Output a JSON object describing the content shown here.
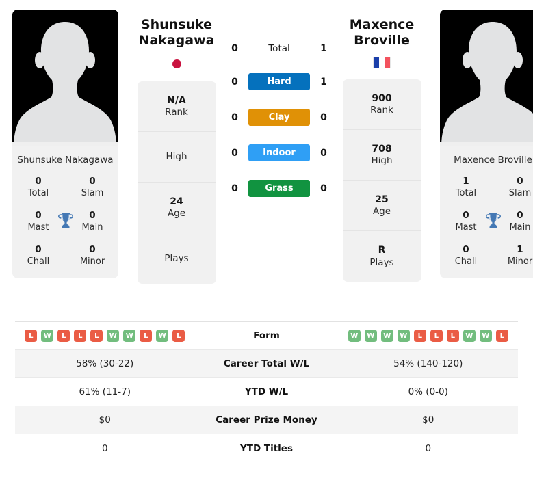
{
  "players": {
    "left": {
      "name": "Shunsuke Nakagawa",
      "name_line1": "Shunsuke",
      "name_line2": "Nakagawa",
      "country_flag": "jp-flag-icon",
      "rank": "N/A",
      "rank_label": "Rank",
      "high": "",
      "high_label": "High",
      "age": "24",
      "age_label": "Age",
      "plays": "",
      "plays_label": "Plays",
      "titles": {
        "total": "0",
        "total_label": "Total",
        "slam": "0",
        "slam_label": "Slam",
        "mast": "0",
        "mast_label": "Mast",
        "main": "0",
        "main_label": "Main",
        "chall": "0",
        "chall_label": "Chall",
        "minor": "0",
        "minor_label": "Minor"
      },
      "form": [
        "L",
        "W",
        "L",
        "L",
        "L",
        "W",
        "W",
        "L",
        "W",
        "L"
      ],
      "career_total_wl": "58% (30-22)",
      "ytd_wl": "61% (11-7)",
      "career_prize_money": "$0",
      "ytd_titles": "0"
    },
    "right": {
      "name": "Maxence Broville",
      "name_line1": "Maxence",
      "name_line2": "Broville",
      "country_flag": "fr-flag-icon",
      "rank": "900",
      "rank_label": "Rank",
      "high": "708",
      "high_label": "High",
      "age": "25",
      "age_label": "Age",
      "plays": "R",
      "plays_label": "Plays",
      "titles": {
        "total": "1",
        "total_label": "Total",
        "slam": "0",
        "slam_label": "Slam",
        "mast": "0",
        "mast_label": "Mast",
        "main": "0",
        "main_label": "Main",
        "chall": "0",
        "chall_label": "Chall",
        "minor": "1",
        "minor_label": "Minor"
      },
      "form": [
        "W",
        "W",
        "W",
        "W",
        "L",
        "L",
        "L",
        "W",
        "W",
        "L"
      ],
      "career_total_wl": "54% (140-120)",
      "ytd_wl": "0% (0-0)",
      "career_prize_money": "$0",
      "ytd_titles": "0"
    }
  },
  "head_to_head": {
    "rows": [
      {
        "label": "Total",
        "left": "0",
        "right": "1",
        "color": "",
        "style": "plain"
      },
      {
        "label": "Hard",
        "left": "0",
        "right": "1",
        "color": "#0571bd",
        "style": "bar"
      },
      {
        "label": "Clay",
        "left": "0",
        "right": "0",
        "color": "#e09106",
        "style": "bar"
      },
      {
        "label": "Indoor",
        "left": "0",
        "right": "0",
        "color": "#2f9ff5",
        "style": "bar"
      },
      {
        "label": "Grass",
        "left": "0",
        "right": "0",
        "color": "#119340",
        "style": "bar"
      }
    ]
  },
  "stats_table": {
    "rows": [
      {
        "label": "Form",
        "left": "",
        "right": "",
        "type": "form"
      },
      {
        "label": "Career Total W/L",
        "left": "58% (30-22)",
        "right": "54% (140-120)",
        "type": "text"
      },
      {
        "label": "YTD W/L",
        "left": "61% (11-7)",
        "right": "0% (0-0)",
        "type": "text"
      },
      {
        "label": "Career Prize Money",
        "left": "$0",
        "right": "$0",
        "type": "text"
      },
      {
        "label": "YTD Titles",
        "left": "0",
        "right": "0",
        "type": "text"
      }
    ]
  },
  "colors": {
    "hard": "#0571bd",
    "clay": "#e09106",
    "indoor": "#2f9ff5",
    "grass": "#119340",
    "win": "#72bd7e",
    "loss": "#ea5c45",
    "card_bg": "#f1f1f1",
    "trophy": "#4478b4"
  }
}
